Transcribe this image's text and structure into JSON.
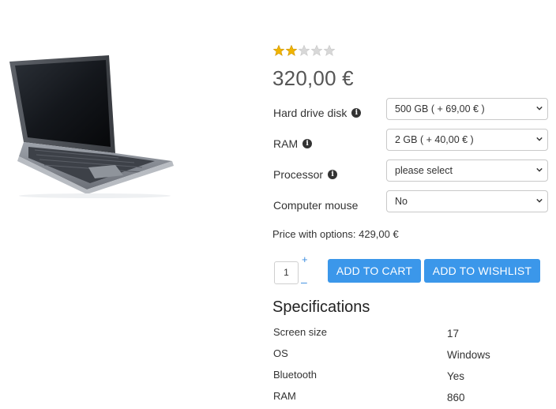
{
  "product": {
    "image_alt": "laptop",
    "rating": 2,
    "rating_max": 5,
    "price": "320,00 €"
  },
  "options": [
    {
      "label": "Hard drive disk",
      "has_info": true,
      "value": "500 GB ( + 69,00 € )"
    },
    {
      "label": "RAM",
      "has_info": true,
      "value": "2 GB ( + 40,00 € )"
    },
    {
      "label": "Processor",
      "has_info": true,
      "value": "please select"
    },
    {
      "label": "Computer mouse",
      "has_info": false,
      "value": "No"
    }
  ],
  "price_with_options": "Price with options: 429,00 €",
  "quantity": {
    "value": "1",
    "plus": "+",
    "minus": "–"
  },
  "buttons": {
    "add_to_cart": "ADD TO CART",
    "add_to_wishlist": "ADD TO WISHLIST"
  },
  "specifications": {
    "title": "Specifications",
    "rows": [
      {
        "name": "Screen size",
        "value": "17"
      },
      {
        "name": "OS",
        "value": "Windows"
      },
      {
        "name": "Bluetooth",
        "value": "Yes"
      },
      {
        "name": "RAM",
        "value": "860"
      }
    ]
  },
  "colors": {
    "star_filled": "#f0b400",
    "star_empty": "#d8d8d8",
    "button": "#3b97ea",
    "link": "#3b8de0"
  }
}
